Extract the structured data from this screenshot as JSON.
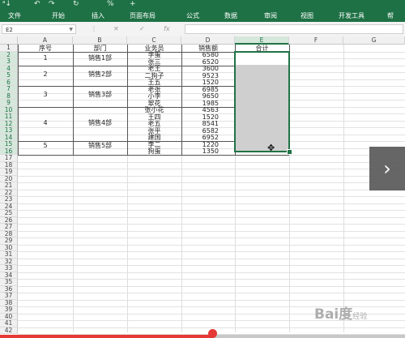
{
  "qat": {
    "sort_label": "ᵃ↓",
    "undo_label": "↶",
    "redo_label": "↷",
    "pct_label": "%",
    "more_label": "+"
  },
  "ribbon": {
    "tabs": [
      "文件",
      "开始",
      "插入",
      "页面布局",
      "公式",
      "数据",
      "审阅",
      "视图",
      "开发工具",
      "帮"
    ]
  },
  "formula_bar": {
    "name_box": "E2",
    "cancel": "✕",
    "confirm": "✓",
    "fx": "fx",
    "formula": ""
  },
  "columns": [
    "A",
    "B",
    "C",
    "D",
    "E",
    "F",
    "G"
  ],
  "rows": [
    "1",
    "2",
    "3",
    "4",
    "5",
    "6",
    "7",
    "8",
    "9",
    "10",
    "11",
    "12",
    "13",
    "14",
    "15",
    "16",
    "17",
    "18",
    "19",
    "20",
    "21",
    "22",
    "23",
    "24",
    "25",
    "26",
    "27",
    "28",
    "29",
    "30",
    "31",
    "32",
    "33",
    "34",
    "35",
    "36",
    "37",
    "38",
    "39",
    "40",
    "41",
    "42"
  ],
  "headers": {
    "a": "序号",
    "b": "部门",
    "c": "业务员",
    "d": "销售额",
    "e": "合计"
  },
  "groups": [
    {
      "no": "1",
      "dept": "销售1部"
    },
    {
      "no": "2",
      "dept": "销售2部"
    },
    {
      "no": "3",
      "dept": "销售3部"
    },
    {
      "no": "4",
      "dept": "销售4部"
    },
    {
      "no": "5",
      "dept": "销售5部"
    }
  ],
  "records": [
    {
      "name": "李蛋",
      "sales": "6580"
    },
    {
      "name": "张三",
      "sales": "6520"
    },
    {
      "name": "老王",
      "sales": "3600"
    },
    {
      "name": "二狗子",
      "sales": "9523"
    },
    {
      "name": "王五",
      "sales": "1520"
    },
    {
      "name": "老张",
      "sales": "6985"
    },
    {
      "name": "小李",
      "sales": "9650"
    },
    {
      "name": "翠花",
      "sales": "1985"
    },
    {
      "name": "张小花",
      "sales": "4563"
    },
    {
      "name": "王四",
      "sales": "1520"
    },
    {
      "name": "老五",
      "sales": "8541"
    },
    {
      "name": "张平",
      "sales": "6582"
    },
    {
      "name": "建国",
      "sales": "6952"
    },
    {
      "name": "李二",
      "sales": "1220"
    },
    {
      "name": "狗蛋",
      "sales": "1350"
    }
  ],
  "nav": {
    "next_label": "›"
  },
  "watermark": {
    "text": "Bai度",
    "sub": "经验"
  },
  "colors": {
    "ribbon": "#1e7145",
    "selection": "#217346",
    "progress": "#e53935"
  }
}
